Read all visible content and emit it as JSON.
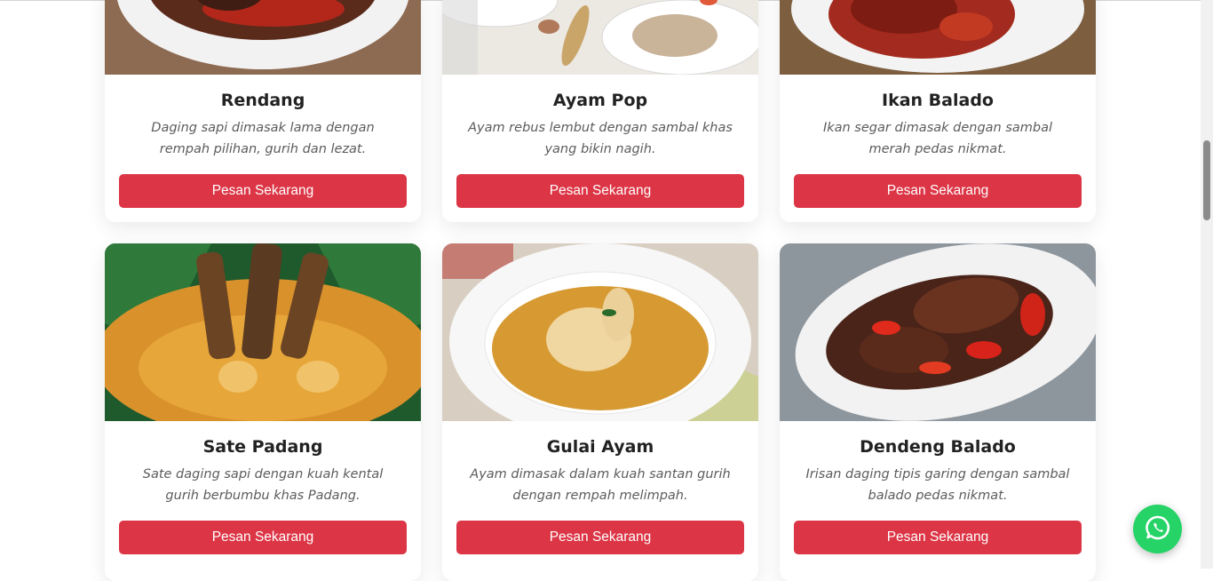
{
  "menu": {
    "items": [
      {
        "name": "Rendang",
        "description": "Daging sapi dimasak lama dengan rempah pilihan, gurih dan lezat.",
        "button": "Pesan Sekarang"
      },
      {
        "name": "Ayam Pop",
        "description": "Ayam rebus lembut dengan sambal khas yang bikin nagih.",
        "button": "Pesan Sekarang"
      },
      {
        "name": "Ikan Balado",
        "description": "Ikan segar dimasak dengan sambal merah pedas nikmat.",
        "button": "Pesan Sekarang"
      },
      {
        "name": "Sate Padang",
        "description": "Sate daging sapi dengan kuah kental gurih berbumbu khas Padang.",
        "button": "Pesan Sekarang"
      },
      {
        "name": "Gulai Ayam",
        "description": "Ayam dimasak dalam kuah santan gurih dengan rempah melimpah.",
        "button": "Pesan Sekarang"
      },
      {
        "name": "Dendeng Balado",
        "description": "Irisan daging tipis garing dengan sambal balado pedas nikmat.",
        "button": "Pesan Sekarang"
      }
    ]
  },
  "colors": {
    "accent": "#dc3545",
    "whatsapp": "#25d366"
  },
  "icons": {
    "floating": "whatsapp-icon"
  }
}
